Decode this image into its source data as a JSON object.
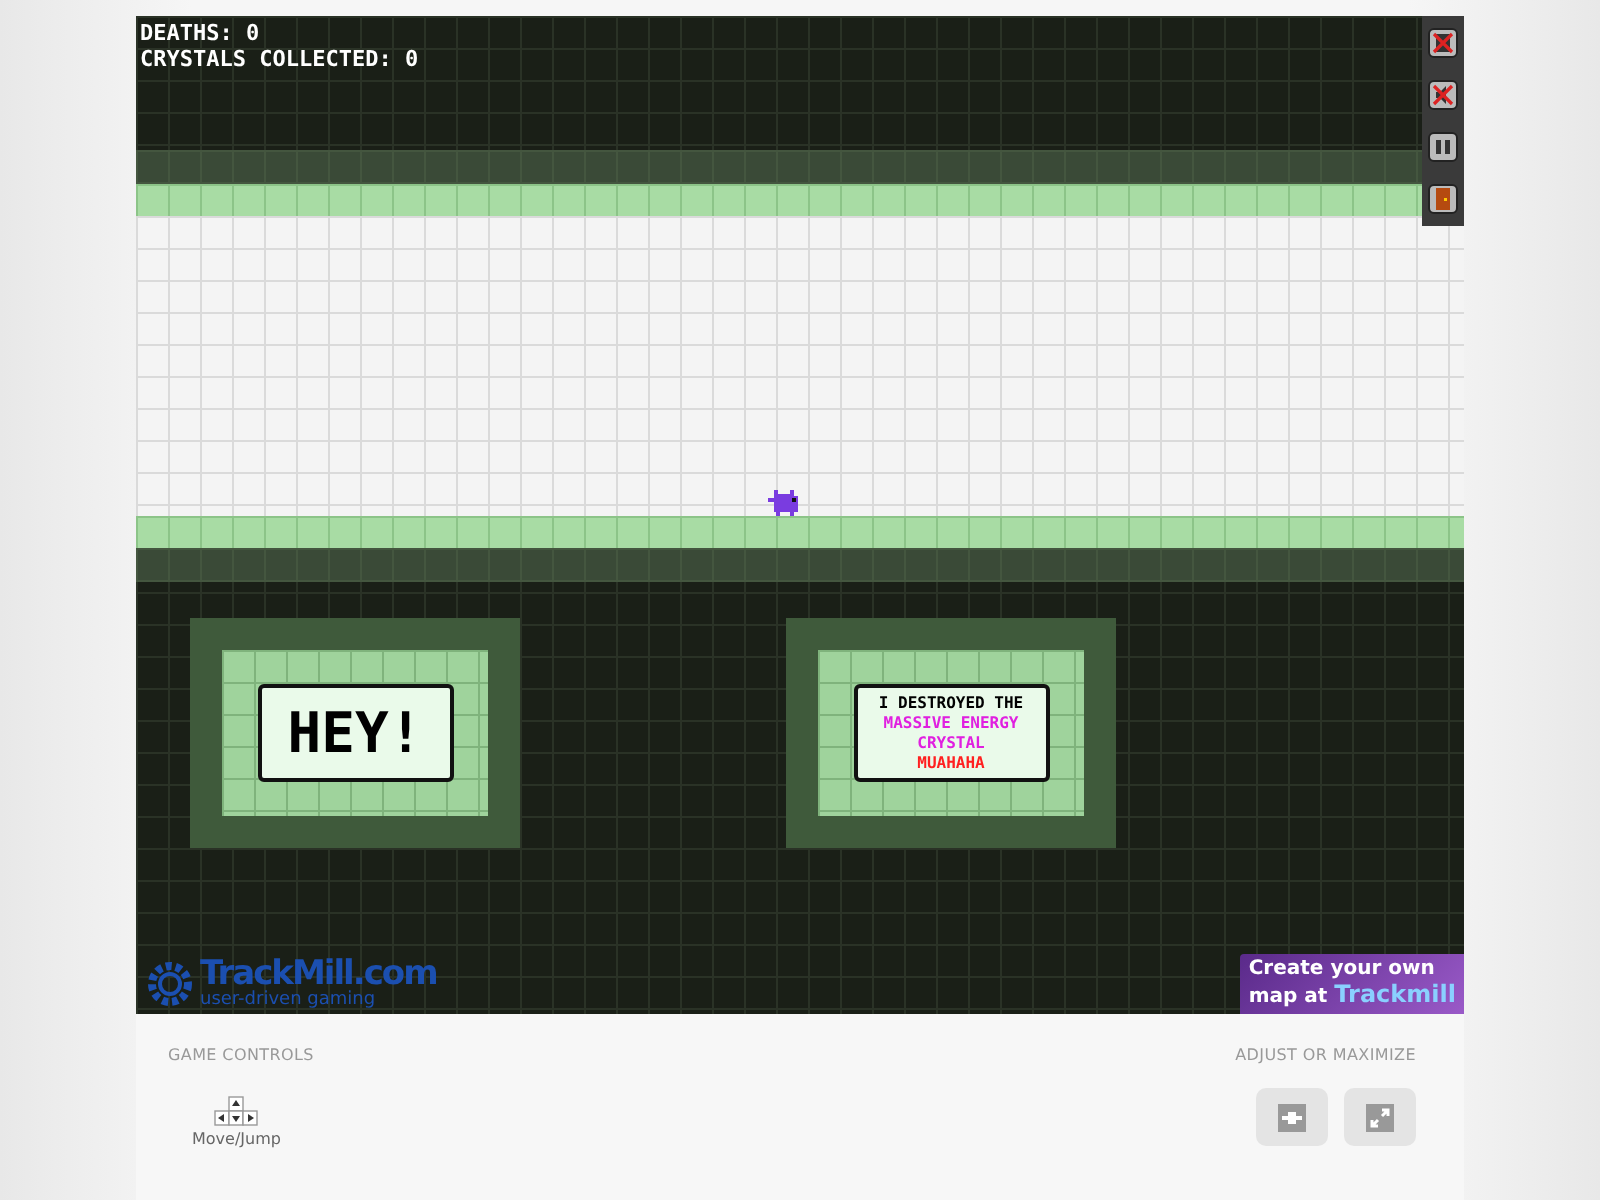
{
  "hud": {
    "deaths": "DEATHS: 0",
    "crystals": "CRYSTALS COLLECTED: 0"
  },
  "signs": [
    {
      "kind": "big",
      "lines": [
        {
          "text": "HEY!",
          "color": "#000000"
        }
      ]
    },
    {
      "kind": "small",
      "lines": [
        {
          "text": "I DESTROYED THE",
          "color": "#000000"
        },
        {
          "text": "MASSIVE ENERGY",
          "color": "#e020e0"
        },
        {
          "text": "CRYSTAL",
          "color": "#e020e0"
        },
        {
          "text": "MUAHAHA",
          "color": "#ff2020"
        }
      ]
    }
  ],
  "logo": {
    "name": "TrackMill.com",
    "tagline": "user-driven gaming"
  },
  "promo": {
    "line1": "Create your own",
    "prefix": "map at",
    "brand": "Trackmill"
  },
  "controls": {
    "title": "GAME CONTROLS",
    "items": [
      {
        "label": "Move/Jump"
      }
    ]
  },
  "adjust": {
    "title": "ADJUST OR MAXIMIZE"
  }
}
